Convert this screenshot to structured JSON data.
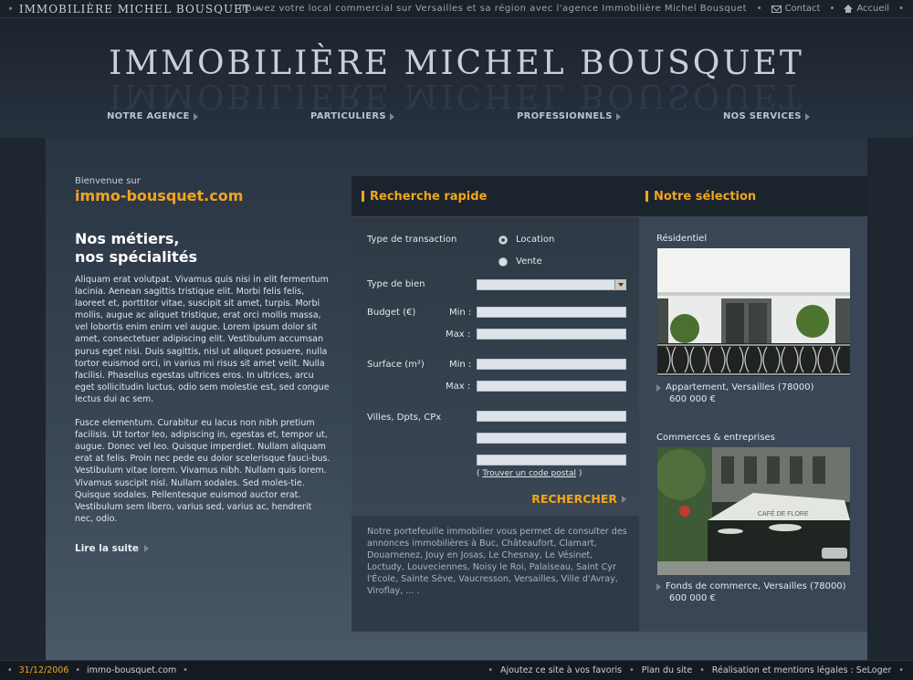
{
  "topbar": {
    "brand": "IMMOBILIÈRE MICHEL BOUSQUET",
    "tagline": "Trouvez votre local commercial sur Versailles et sa région avec l'agence Immobilière Michel Bousquet",
    "contact": "Contact",
    "accueil": "Accueil"
  },
  "header": {
    "logo": "IMMOBILIÈRE MICHEL BOUSQUET",
    "nav": [
      "NOTRE AGENCE",
      "PARTICULIERS",
      "PROFESSIONNELS",
      "NOS SERVICES"
    ]
  },
  "left": {
    "welcome": "Bienvenue sur",
    "site": "immo-bousquet.com",
    "heading_line1": "Nos métiers,",
    "heading_line2": "nos spécialités",
    "para1": "Aliquam erat volutpat. Vivamus quis nisi in elit fermentum lacinia. Aenean sagittis tristique elit. Morbi felis felis, laoreet et, porttitor vitae, suscipit sit amet, turpis. Morbi mollis, augue ac aliquet tristique, erat orci mollis massa, vel lobortis enim enim vel augue. Lorem ipsum dolor sit amet, consectetuer adipiscing elit. Vestibulum accumsan purus eget nisi. Duis sagittis, nisl ut aliquet posuere, nulla tortor euismod orci, in varius mi risus sit amet velit. Nulla facilisi. Phasellus egestas ultrices eros. In ultrices, arcu eget sollicitudin luctus, odio sem molestie est, sed congue lectus dui ac sem.",
    "para2": "Fusce elementum. Curabitur eu lacus non nibh pretium facilisis. Ut tortor leo, adipiscing in, egestas et, tempor ut, augue. Donec vel leo. Quisque imperdiet. Nullam aliquam erat at felis. Proin nec pede eu dolor scelerisque fauci-bus. Vestibulum vitae lorem. Vivamus nibh. Nullam quis lorem. Vivamus suscipit nisl. Nullam sodales. Sed moles-tie. Quisque sodales. Pellentesque euismod auctor erat. Vestibulum sem libero, varius sed, varius ac, hendrerit nec, odio.",
    "readmore": "Lire la suite"
  },
  "search": {
    "title": "Recherche rapide",
    "transaction_label": "Type de transaction",
    "opt_location": "Location",
    "opt_vente": "Vente",
    "bien_label": "Type de bien",
    "budget_label": "Budget (€)",
    "surface_label": "Surface (m²)",
    "min": "Min :",
    "max": "Max :",
    "villes_label": "Villes, Dpts, CPx",
    "code_open": "(",
    "code_link": "Trouver un code postal",
    "code_close": ")",
    "button": "RECHERCHER",
    "portfolio": "Notre portefeuille immobilier vous permet de consulter des annonces immobilières à Buc, Châteaufort, Clamart, Douarnenez, Jouy en Josas, Le Chesnay, Le Vésinet, Loctudy, Louveciennes, Noisy le Roi, Palaiseau, Saint Cyr l'École, Sainte Sève, Vaucresson, Versailles, Ville d'Avray, Viroflay, ... ."
  },
  "selection": {
    "title": "Notre sélection",
    "items": [
      {
        "category": "Résidentiel",
        "desc": "Appartement, Versailles (78000)",
        "price": "600 000 €"
      },
      {
        "category": "Commerces & entreprises",
        "desc": "Fonds de commerce, Versailles (78000)",
        "price": "600 000 €"
      }
    ],
    "cafe_sign": "CAFÉ DE FLORE"
  },
  "footer": {
    "date": "31/12/2006",
    "site": "immo-bousquet.com",
    "favoris": "Ajoutez ce site à vos favoris",
    "plan": "Plan du site",
    "realisation": "Réalisation et mentions légales : SeLoger"
  }
}
